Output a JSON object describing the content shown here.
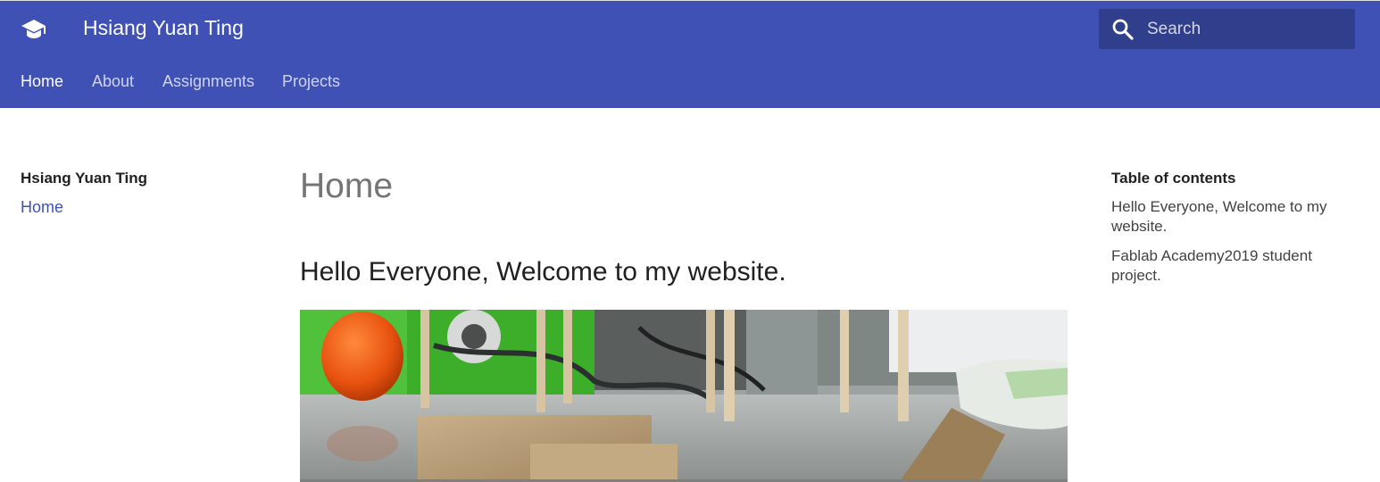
{
  "header": {
    "site_title": "Hsiang Yuan Ting",
    "logo_icon": "graduation-cap-icon",
    "brand_color": "#3f51b5"
  },
  "search": {
    "placeholder": "Search",
    "icon": "search-icon"
  },
  "tabs": [
    {
      "label": "Home",
      "active": true
    },
    {
      "label": "About",
      "active": false
    },
    {
      "label": "Assignments",
      "active": false
    },
    {
      "label": "Projects",
      "active": false
    }
  ],
  "nav": {
    "title": "Hsiang Yuan Ting",
    "items": [
      {
        "label": "Home"
      }
    ]
  },
  "main": {
    "page_title": "Home",
    "section_heading": "Hello Everyone, Welcome to my website."
  },
  "toc": {
    "title": "Table of contents",
    "items": [
      {
        "label": "Hello Everyone, Welcome to my website."
      },
      {
        "label": "Fablab Academy2019 student project."
      }
    ]
  }
}
